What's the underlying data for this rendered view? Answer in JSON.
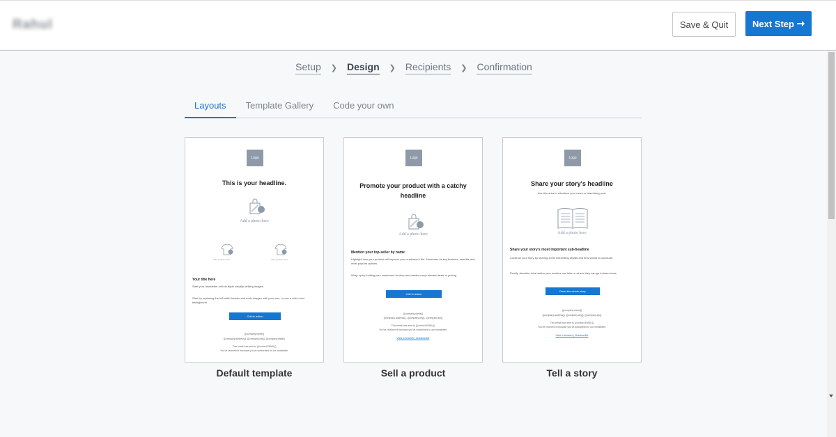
{
  "header": {
    "username": "Rahul",
    "save_quit_label": "Save & Quit",
    "next_step_label": "Next Step",
    "next_step_icon": "arrow-right-icon"
  },
  "breadcrumb": {
    "steps": [
      "Setup",
      "Design",
      "Recipients",
      "Confirmation"
    ],
    "active": "Design"
  },
  "tabs": {
    "items": [
      "Layouts",
      "Template Gallery",
      "Code your own"
    ],
    "active": "Layouts"
  },
  "cards": [
    {
      "title": "Default template",
      "preview": {
        "logo": "Logo",
        "headline": "This is your headline.",
        "photo_label": "Add a photo here",
        "small_photo_label_1": "Add a photo here",
        "small_photo_label_2": "Add a photo here",
        "subtitle": "Your title here",
        "body_1": "Start your newsletter with multiple visually striking images.",
        "body_2": "Start by replacing the full-width header and main images with your own, or use a solid color background.",
        "cta": "Call to action",
        "company_name": "{{company.name}}",
        "company_address": "{{company.address}}, {{company.city}}, {{company.state}}",
        "sent_to": "This email was sent to {{contact.EMAIL}}",
        "reason": "You've received it because you've subscribed to our newsletter."
      }
    },
    {
      "title": "Sell a product",
      "preview": {
        "logo": "Logo",
        "headline": "Promote your product with a catchy headline",
        "photo_label": "Add a photo here",
        "subtitle": "Mention your top-seller by name",
        "body_1": "Highlight how your product will improve your customer's life. Showcase its key features, benefits and most popular options.",
        "body_2": "Wrap up by inviting your customers to shop and mention any relevant deals or pricing.",
        "cta": "Call to action",
        "company_name": "{{company.name}}",
        "company_address": "{{company.address}}, {{company.city}}, {{company.zip}}",
        "sent_to": "This email was sent to {{contact.EMAIL}}",
        "reason": "You've received it because you've subscribed to our newsletter.",
        "links": "View in browser | Unsubscribe"
      }
    },
    {
      "title": "Tell a story",
      "preview": {
        "logo": "Logo",
        "headline": "Share your story's headline",
        "intro": "Use this area to introduce your news or latest blog post.",
        "photo_label": "Add a photo here",
        "subtitle": "Share your story's most important sub-headline",
        "body_1": "Continue your story by sharing some interesting details and final words to conclude.",
        "body_2": "Finally, describe what action your readers can take or where they can go to learn more.",
        "cta": "Read the whole story",
        "company_name": "{{company.name}}",
        "company_address": "{{company.address}}, {{company.city}}, {{company.zip}}",
        "sent_to": "This email was sent to {{contact.EMAIL}}",
        "reason": "You've received it because you've subscribed to our newsletter.",
        "links": "View in browser | Unsubscribe"
      }
    }
  ],
  "colors": {
    "accent": "#1677d2",
    "background": "#f7f8fa",
    "logo_placeholder": "#8e9aa7"
  }
}
